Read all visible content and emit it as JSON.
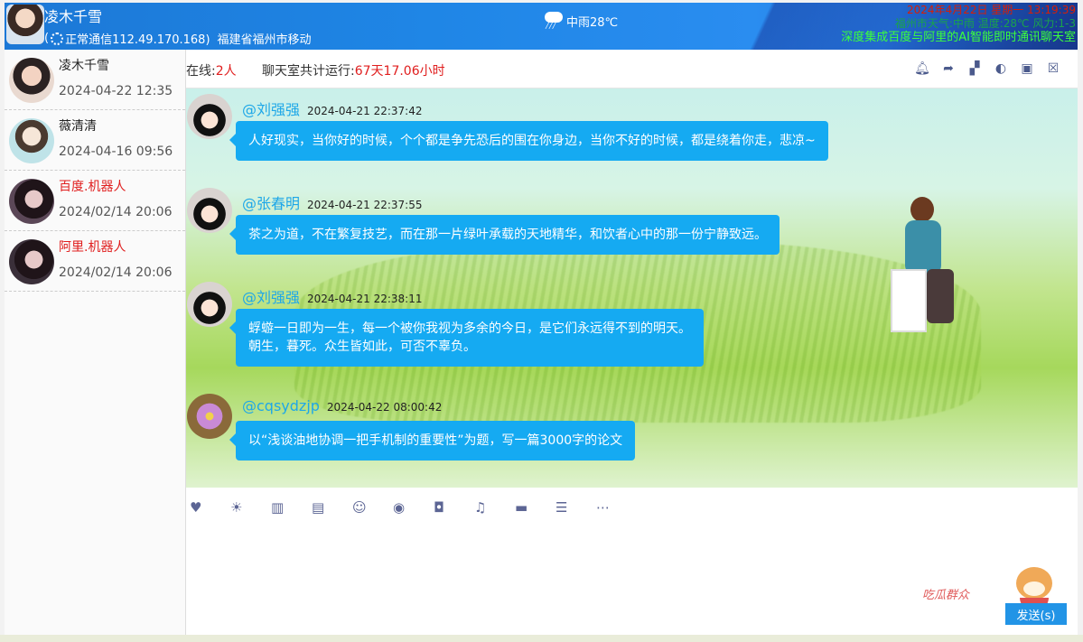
{
  "header": {
    "user_name": "凌木千雪",
    "status": "正常通信112.49.170.168)",
    "status_prefix": "(",
    "location": "福建省福州市移动",
    "weather": "中雨28℃",
    "datetime": "2024年4月22日  星期一  13:19:39",
    "weather_detail": "福州市天气:中雨 温度:28℃ 风力:1-3",
    "ai_banner": "深度集成百度与阿里的AI智能即时通讯聊天室"
  },
  "sidebar": {
    "contacts": [
      {
        "name": "凌木千雪",
        "time": "2024-04-22 12:35",
        "highlight": false
      },
      {
        "name": "薇清清",
        "time": "2024-04-16 09:56",
        "highlight": false
      },
      {
        "name": "百度.机器人",
        "time": "2024/02/14 20:06",
        "highlight": true
      },
      {
        "name": "阿里.机器人",
        "time": "2024/02/14 20:06",
        "highlight": true
      }
    ]
  },
  "topbar": {
    "online_label": "在线:",
    "online_count": "2人",
    "uptime_label": "聊天室共计运行:",
    "uptime_value": "67天17.06小时",
    "icons": [
      "bell-icon",
      "share-icon",
      "chess-icon",
      "toggle-icon",
      "rss-icon",
      "trash-icon"
    ]
  },
  "messages": [
    {
      "user": "@刘强强",
      "time": "2024-04-21 22:37:42",
      "text": "人好现实，当你好的时候，个个都是争先恐后的围在你身边，当你不好的时候，都是绕着你走，悲凉~",
      "avatar": "cartoon"
    },
    {
      "user": "@张春明",
      "time": "2024-04-21 22:37:55",
      "text": "茶之为道，不在繁复技艺，而在那一片绿叶承载的天地精华，和饮者心中的那一份宁静致远。",
      "avatar": "cartoon"
    },
    {
      "user": "@刘强强",
      "time": "2024-04-21 22:38:11",
      "text_line1": "蜉蝣一日即为一生，每一个被你我视为多余的今日，是它们永远得不到的明天。",
      "text_line2": "朝生，暮死。众生皆如此，可否不辜负。",
      "avatar": "cartoon"
    },
    {
      "user": "@cqsydzjp",
      "time": "2024-04-22 08:00:42",
      "text": "以“浅谈油地协调一把手机制的重要性”为题，写一篇3000字的论文",
      "avatar": "lotus"
    }
  ],
  "toolbar": {
    "tools": [
      "heart-icon",
      "sun-icon",
      "map-icon",
      "id-card-icon",
      "smile-icon",
      "user-circle-icon",
      "camera-icon",
      "music-icon",
      "folder-icon",
      "server-icon",
      "more-icon"
    ]
  },
  "composer": {
    "sticker_text": "吃瓜群众",
    "send_label": "发送(s)"
  },
  "colors": {
    "header_blue": "#1f86e6",
    "bubble_blue": "#15aaf2",
    "username_blue": "#1ea7e8",
    "alert_red": "#e01e1e",
    "icon_purple": "#5c6594"
  }
}
